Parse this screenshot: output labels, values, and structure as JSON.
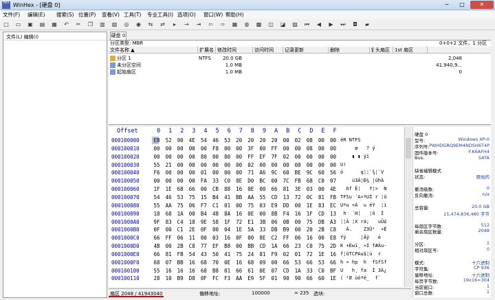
{
  "window": {
    "app_icon": "HEX",
    "title": "WinHex - [硬盘 0]",
    "min": "─",
    "max": "□",
    "close": "✕"
  },
  "menu": [
    "文件(F)",
    "编辑(E)",
    "搜索(S)",
    "位置(P)",
    "查看(V)",
    "工具(T)",
    "专业工具(I)",
    "选项(O)",
    "窗口(W)",
    "帮助(H)"
  ],
  "toolbar_icons": [
    "new-icon",
    "open-icon",
    "save-icon",
    "print-icon",
    "properties-icon",
    "undo-icon",
    "cut-icon",
    "copy-icon",
    "paste-icon",
    "paste-special-icon",
    "find-icon",
    "find-hex-icon",
    "replace-icon",
    "replace-hex-icon",
    "find-next-icon",
    "goto-offset-icon",
    "goto-sector-icon",
    "back-icon",
    "forward-icon",
    "calculator-icon",
    "disk-editor-icon",
    "ram-icon",
    "clone-icon",
    "image-icon",
    "interpret-icon",
    "first-sector-icon",
    "prev-sector-icon",
    "next-sector-icon",
    "last-sector-icon",
    "snapshot-icon",
    "help-icon"
  ],
  "left_panel": {
    "header": "文件(L) 编辑(I)"
  },
  "tab": {
    "label": "硬盘 0"
  },
  "partition_bar": {
    "type": "分区类型: MBR",
    "info": "0+0+2 文件，1 分区"
  },
  "partition_table": {
    "headers": [
      "文件名称 ▲",
      "扩展名",
      "修改时间",
      "访问时间",
      "记录更新",
      "删除",
      "链接",
      "头扇区",
      "1st 扇区"
    ],
    "rows": [
      {
        "icon": "partition-icon",
        "name": "分区 1",
        "ext": "NTFS",
        "size": "20.0 GB",
        "first": "2,048"
      },
      {
        "icon": "unallocated-icon",
        "name": "未分区空间",
        "ext": "",
        "size": "1.0 MB",
        "first": "41,940,9..."
      },
      {
        "icon": "boot-sector-icon",
        "name": "起始扇区",
        "ext": "",
        "size": "1.0 MB",
        "first": "0"
      }
    ]
  },
  "hex": {
    "offset_label": "Offset",
    "columns": [
      "0",
      "1",
      "2",
      "3",
      "4",
      "5",
      "6",
      "7",
      "8",
      "9",
      "A",
      "B",
      "C",
      "D",
      "E",
      "F"
    ],
    "rows": [
      {
        "off": "000100000",
        "b": [
          "EB",
          "52",
          "90",
          "4E",
          "54",
          "46",
          "53",
          "20",
          "20",
          "20",
          "20",
          "00",
          "02",
          "08",
          "00",
          "00"
        ],
        "t": "ëR NTFS"
      },
      {
        "off": "000100010",
        "b": [
          "00",
          "00",
          "00",
          "00",
          "00",
          "F8",
          "00",
          "00",
          "3F",
          "00",
          "FF",
          "00",
          "00",
          "08",
          "00",
          "00"
        ],
        "t": "     ø   ? ÿ"
      },
      {
        "off": "000100020",
        "b": [
          "00",
          "00",
          "00",
          "00",
          "80",
          "00",
          "80",
          "00",
          "FF",
          "EF",
          "7F",
          "02",
          "00",
          "00",
          "00",
          "00"
        ],
        "t": "    ▮ ▮ ÿï"
      },
      {
        "off": "000100030",
        "b": [
          "55",
          "21",
          "00",
          "00",
          "00",
          "00",
          "00",
          "00",
          "02",
          "00",
          "00",
          "00",
          "00",
          "00",
          "00",
          "00"
        ],
        "t": "U!"
      },
      {
        "off": "000100040",
        "b": [
          "F6",
          "00",
          "00",
          "00",
          "01",
          "00",
          "00",
          "00",
          "71",
          "A6",
          "9C",
          "60",
          "BE",
          "9C",
          "60",
          "56"
        ],
        "t": "ö      q¦¦`¾¦`V"
      },
      {
        "off": "000100050",
        "b": [
          "00",
          "00",
          "00",
          "00",
          "FA",
          "33",
          "C0",
          "8E",
          "D0",
          "BC",
          "00",
          "7C",
          "FB",
          "68",
          "C0",
          "07"
        ],
        "t": "    ú3À¦Ð¼ |ûhÀ"
      },
      {
        "off": "000100060",
        "b": [
          "1F",
          "1E",
          "68",
          "66",
          "00",
          "CB",
          "88",
          "16",
          "0E",
          "00",
          "66",
          "81",
          "3E",
          "03",
          "00",
          "4E"
        ],
        "t": "  hf Ë¦   f¦>  N"
      },
      {
        "off": "000100070",
        "b": [
          "54",
          "46",
          "53",
          "75",
          "15",
          "B4",
          "41",
          "BB",
          "AA",
          "55",
          "CD",
          "13",
          "72",
          "0C",
          "81",
          "FB"
        ],
        "t": "TFSu ´A»ªUÍ r ¦û"
      },
      {
        "off": "000100080",
        "b": [
          "55",
          "AA",
          "75",
          "06",
          "F7",
          "C1",
          "01",
          "00",
          "75",
          "03",
          "E9",
          "DD",
          "00",
          "1E",
          "83",
          "EC"
        ],
        "t": "Uªu ÷Á  u éÝ  ¦ì"
      },
      {
        "off": "000100090",
        "b": [
          "18",
          "68",
          "1A",
          "00",
          "B4",
          "48",
          "8A",
          "16",
          "0E",
          "00",
          "8B",
          "F4",
          "16",
          "1F",
          "CD",
          "13"
        ],
        "t": " h  ´H¦   ¦ô  Í"
      },
      {
        "off": "0001000A0",
        "b": [
          "9F",
          "83",
          "C4",
          "18",
          "9E",
          "58",
          "1F",
          "72",
          "E1",
          "3B",
          "06",
          "0B",
          "00",
          "75",
          "DB",
          "A3"
        ],
        "t": "¦¦Ä ¦X rá;   uÛ£"
      },
      {
        "off": "0001000B0",
        "b": [
          "0F",
          "00",
          "C1",
          "2E",
          "0F",
          "00",
          "04",
          "1E",
          "5A",
          "33",
          "DB",
          "B9",
          "00",
          "20",
          "2B",
          "C8"
        ],
        "t": "  Á.    Z3Û¹  +È"
      },
      {
        "off": "0001000C0",
        "b": [
          "66",
          "FF",
          "06",
          "11",
          "00",
          "03",
          "16",
          "0F",
          "00",
          "8E",
          "C2",
          "FF",
          "06",
          "16",
          "00",
          "E8"
        ],
        "t": "fÿ     ¦Âÿ   è"
      },
      {
        "off": "0001000D0",
        "b": [
          "4B",
          "00",
          "2B",
          "C8",
          "77",
          "EF",
          "B8",
          "00",
          "BB",
          "CD",
          "1A",
          "66",
          "23",
          "C0",
          "75",
          "2D"
        ],
        "t": "K +Èwï¸ »Í f#Àu-"
      },
      {
        "off": "0001000E0",
        "b": [
          "66",
          "81",
          "FB",
          "54",
          "43",
          "50",
          "41",
          "75",
          "24",
          "81",
          "F9",
          "02",
          "01",
          "72",
          "1E",
          "16"
        ],
        "t": "f¦ûTCPAu$¦ù  r"
      },
      {
        "off": "0001000F0",
        "b": [
          "68",
          "07",
          "BB",
          "16",
          "68",
          "70",
          "0E",
          "16",
          "68",
          "09",
          "00",
          "66",
          "53",
          "66",
          "53",
          "66"
        ],
        "t": "h » hp  h  fSfSf"
      },
      {
        "off": "000100100",
        "b": [
          "55",
          "16",
          "16",
          "16",
          "68",
          "B8",
          "01",
          "66",
          "61",
          "0E",
          "07",
          "CD",
          "1A",
          "33",
          "C0",
          "BF"
        ],
        "t": "U   h¸ fa  Í 3À¿"
      },
      {
        "off": "000100110",
        "b": [
          "28",
          "10",
          "B9",
          "D8",
          "0F",
          "FC",
          "F3",
          "AA",
          "E9",
          "5F",
          "01",
          "90",
          "90",
          "66",
          "60",
          "1E"
        ],
        "t": "( ¹Ø üóªé_  f`"
      }
    ]
  },
  "info_panel": [
    {
      "l": "硬盘 0",
      "v": ""
    },
    {
      "l": "型号:",
      "v": "Windows XP-0"
    },
    {
      "l": "序列号:",
      "v": "PWHDGRQ9EM4NDSH6T4P"
    },
    {
      "l": "固件版本号:",
      "v": "F.K6AFH4"
    },
    {
      "l": "Bus:",
      "v": "SATA"
    },
    {
      "l": "",
      "v": ""
    },
    {
      "l": "缺省编辑模式",
      "v": ""
    },
    {
      "l": "状态:",
      "v": "原始的"
    },
    {
      "l": "",
      "v": ""
    },
    {
      "l": "撤消级数:",
      "v": "0"
    },
    {
      "l": "反向撤消:",
      "v": "n/a"
    },
    {
      "l": "",
      "v": ""
    },
    {
      "l": "总容量:",
      "v": "20.0 GB"
    },
    {
      "l": "",
      "v": "21,474,836,480 字节"
    },
    {
      "l": "",
      "v": ""
    },
    {
      "l": "每扇区字节数:",
      "v": "512"
    },
    {
      "l": "剩余扇区数量:",
      "v": "2048"
    },
    {
      "l": "",
      "v": ""
    },
    {
      "l": "分区:",
      "v": "1"
    },
    {
      "l": "相对扇区号:",
      "v": "0"
    },
    {
      "l": "",
      "v": ""
    },
    {
      "l": "模式:",
      "v": "十六进制"
    },
    {
      "l": "字符集:",
      "v": "CP 936"
    },
    {
      "l": "偏移地址:",
      "v": "十六进制"
    },
    {
      "l": "每页字节数:",
      "v": "19x16=304"
    },
    {
      "l": "当前窗口:",
      "v": "1"
    },
    {
      "l": "窗口总数:",
      "v": "1"
    }
  ],
  "info_blue_values": [
    "Windows XP-0",
    "PWHDGRQ9EM4NDSH6T4P",
    "F.K6AFH4",
    "SATA",
    "原始的",
    "0",
    "n/a",
    "20.0 GB",
    "21,474,836,480 字节",
    "512",
    "2048",
    "1",
    "0",
    "十六进制",
    "CP 936",
    "19x16=304"
  ],
  "status": {
    "sector": "扇区 2048 / 41943040",
    "offset_label": "偏移地址:",
    "offset_value": "100000",
    "eq": "= 235",
    "sel_label": "选块:",
    "na": "n/a",
    "size_label": "大小:",
    "na2": "n/a"
  },
  "colors": {
    "accent": "#0000a8",
    "highlight": "#e00000"
  }
}
